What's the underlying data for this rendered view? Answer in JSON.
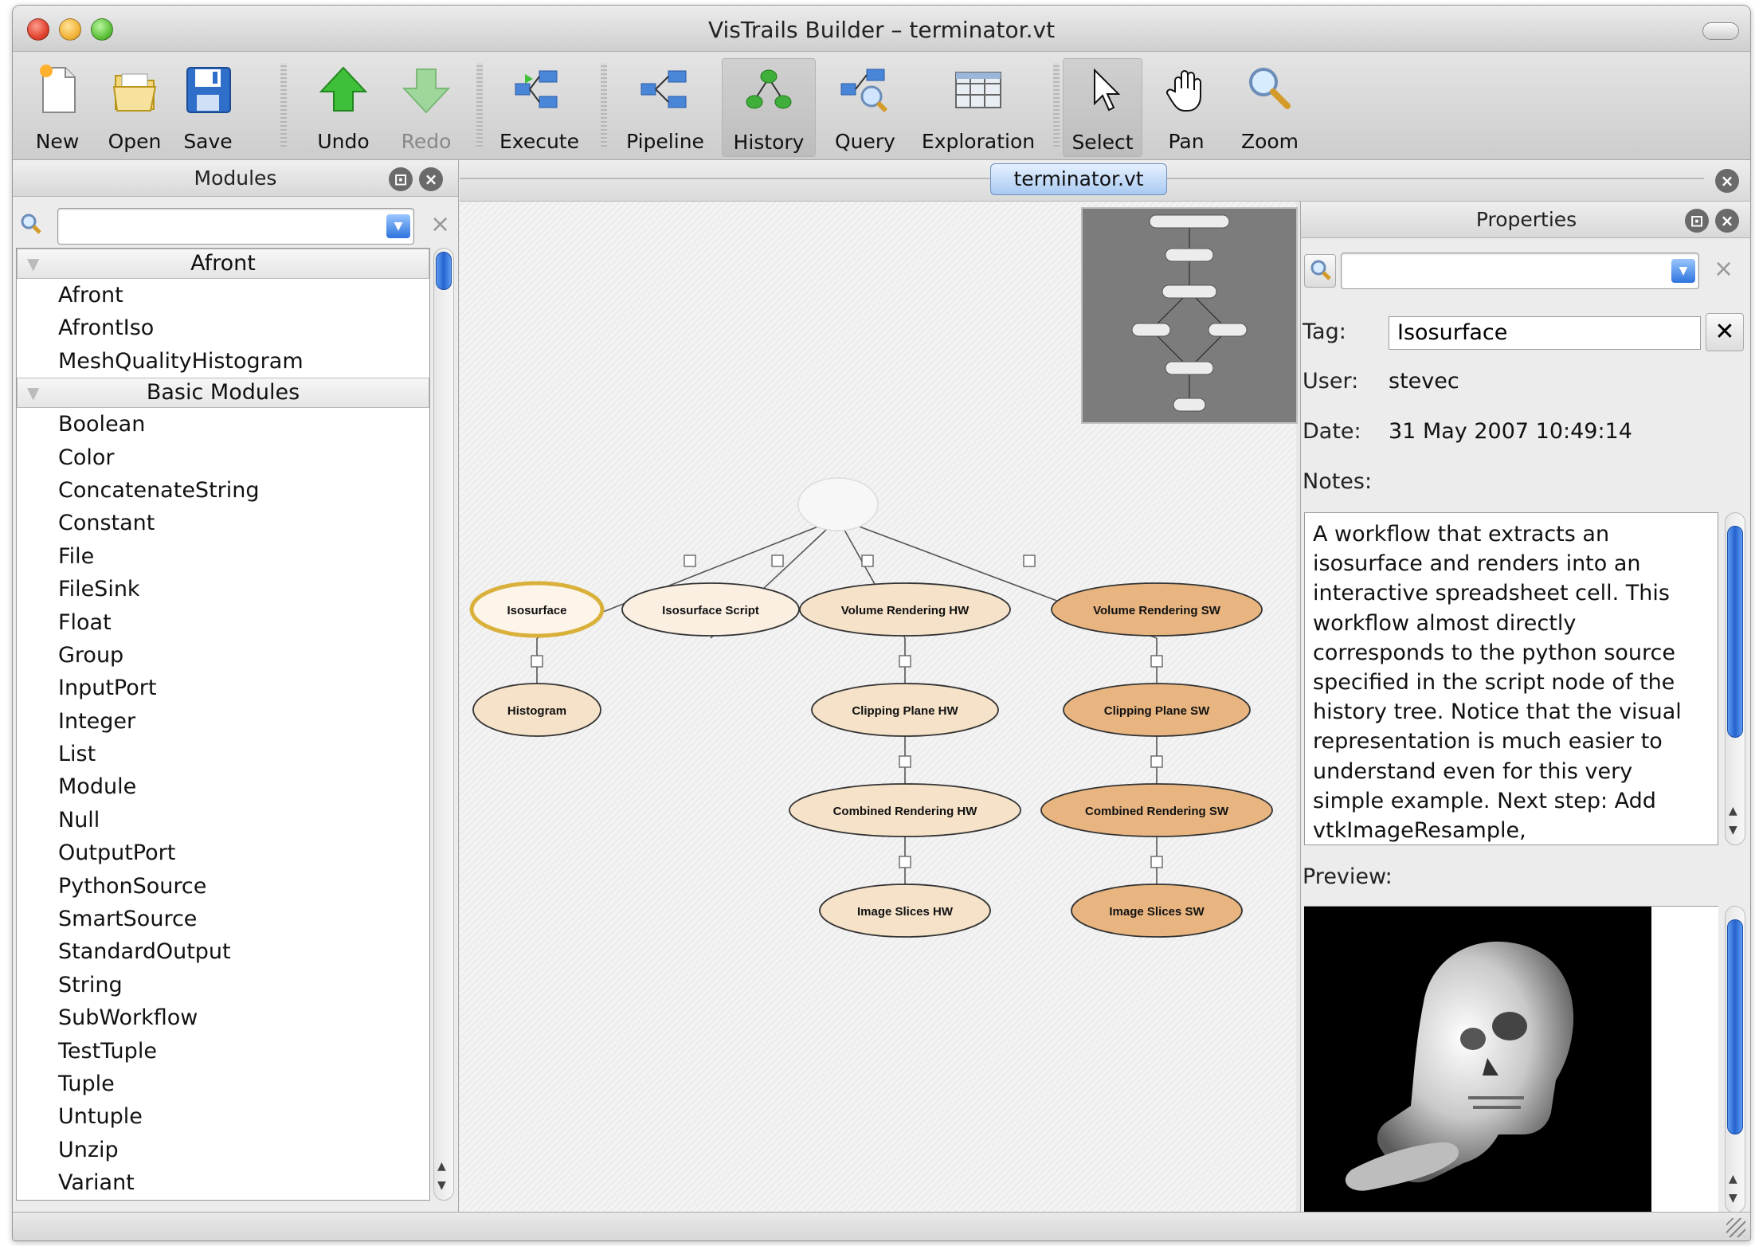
{
  "window": {
    "title": "VisTrails Builder – terminator.vt"
  },
  "toolbar": {
    "new": "New",
    "open": "Open",
    "save": "Save",
    "undo": "Undo",
    "redo": "Redo",
    "execute": "Execute",
    "pipeline": "Pipeline",
    "history": "History",
    "query": "Query",
    "exploration": "Exploration",
    "select": "Select",
    "pan": "Pan",
    "zoom": "Zoom"
  },
  "modules": {
    "title": "Modules",
    "categories": [
      {
        "name": "Afront",
        "items": [
          "Afront",
          "AfrontIso",
          "MeshQualityHistogram"
        ]
      },
      {
        "name": "Basic Modules",
        "items": [
          "Boolean",
          "Color",
          "ConcatenateString",
          "Constant",
          "File",
          "FileSink",
          "Float",
          "Group",
          "InputPort",
          "Integer",
          "List",
          "Module",
          "Null",
          "OutputPort",
          "PythonSource",
          "SmartSource",
          "StandardOutput",
          "String",
          "SubWorkflow",
          "TestTuple",
          "Tuple",
          "Untuple",
          "Unzip",
          "Variant"
        ]
      }
    ]
  },
  "tab": {
    "label": "terminator.vt"
  },
  "graph": {
    "nodes": {
      "isosurface": "Isosurface",
      "isosurface_script": "Isosurface Script",
      "volume_hw": "Volume Rendering HW",
      "volume_sw": "Volume Rendering SW",
      "histogram": "Histogram",
      "clip_hw": "Clipping Plane HW",
      "clip_sw": "Clipping Plane SW",
      "comb_hw": "Combined Rendering HW",
      "comb_sw": "Combined Rendering SW",
      "slices_hw": "Image Slices HW",
      "slices_sw": "Image Slices SW"
    }
  },
  "properties": {
    "title": "Properties",
    "tag_label": "Tag:",
    "tag_value": "Isosurface",
    "user_label": "User:",
    "user_value": "stevec",
    "date_label": "Date:",
    "date_value": "31 May 2007 10:49:14",
    "notes_label": "Notes:",
    "notes_lines": [
      "A workflow that extracts an",
      "isosurface and renders into an",
      "interactive spreadsheet cell. This",
      "workflow almost directly",
      "corresponds to the python source",
      "specified in the script node of the",
      "history tree. Notice that the visual",
      "representation is much easier to",
      "understand even for this very",
      "simple example. Next step: Add",
      "vtkImageResample,"
    ],
    "preview_label": "Preview:"
  },
  "colors": {
    "selected_node_border": "#d9b13a",
    "hw_node": "#f6e2c9",
    "sw_node": "#e8b581",
    "tab": "#a9c9f2"
  }
}
